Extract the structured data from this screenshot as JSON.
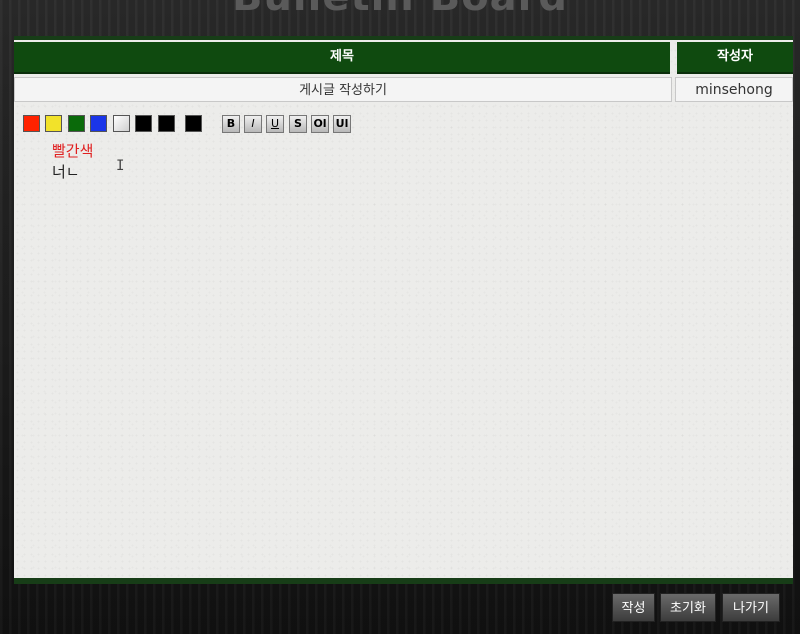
{
  "page": {
    "title": "Bulletin Board"
  },
  "table": {
    "title_header": "제목",
    "author_header": "작성자",
    "title_value": "게시글 작성하기",
    "author_value": "minsehong"
  },
  "toolbar": {
    "colors": [
      "#ff2200",
      "#f2e22a",
      "#0a6a0a",
      "#1a35e8",
      "#ffffff",
      "#000000",
      "#000000",
      "#000000"
    ],
    "format_buttons": [
      "B",
      "I",
      "U",
      "S",
      "Ol",
      "Ul"
    ]
  },
  "editor": {
    "lines": [
      "빨간색",
      "너ㄴ"
    ]
  },
  "footer": {
    "submit": "작성",
    "reset": "초기화",
    "exit": "나가기"
  }
}
